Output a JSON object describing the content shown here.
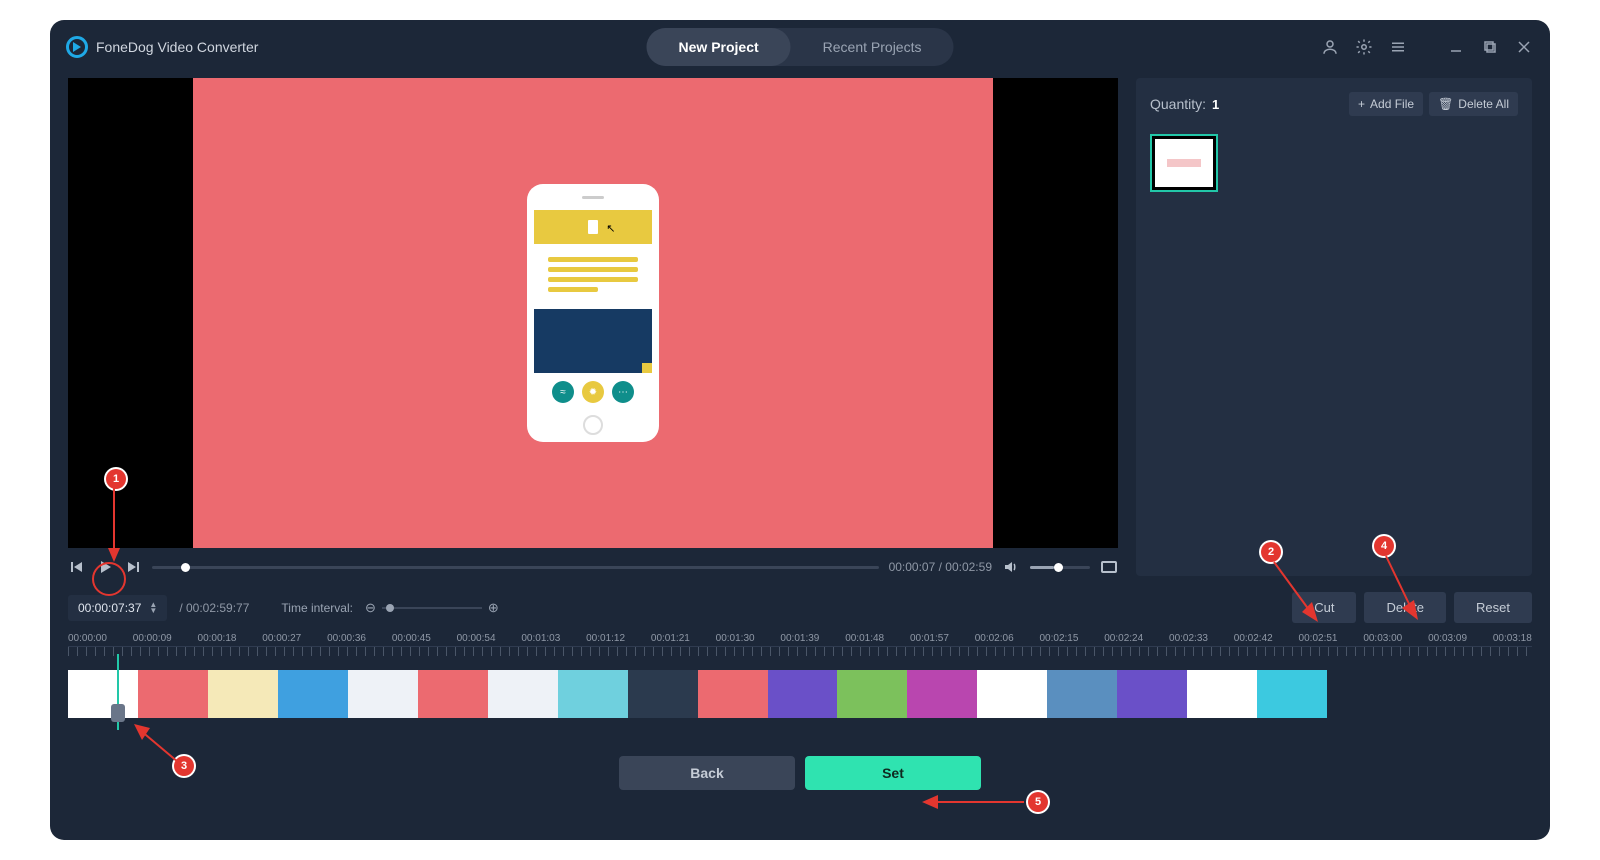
{
  "app": {
    "title": "FoneDog Video Converter"
  },
  "tabs": {
    "new": "New Project",
    "recent": "Recent Projects"
  },
  "sidebar": {
    "quantity_label": "Quantity:",
    "quantity_value": "1",
    "add_file": "Add File",
    "delete_all": "Delete All"
  },
  "playback": {
    "time": "00:00:07 / 00:02:59"
  },
  "interval": {
    "current_tc": "00:00:07:37",
    "duration": "/ 00:02:59:77",
    "label": "Time interval:"
  },
  "actions": {
    "cut": "Cut",
    "delete": "Delete",
    "reset": "Reset"
  },
  "ruler": [
    "00:00:00",
    "00:00:09",
    "00:00:18",
    "00:00:27",
    "00:00:36",
    "00:00:45",
    "00:00:54",
    "00:01:03",
    "00:01:12",
    "00:01:21",
    "00:01:30",
    "00:01:39",
    "00:01:48",
    "00:01:57",
    "00:02:06",
    "00:02:15",
    "00:02:24",
    "00:02:33",
    "00:02:42",
    "00:02:51",
    "00:03:00",
    "00:03:09",
    "00:03:18"
  ],
  "footer": {
    "back": "Back",
    "set": "Set"
  },
  "annotations": {
    "b1": "1",
    "b2": "2",
    "b3": "3",
    "b4": "4",
    "b5": "5"
  }
}
